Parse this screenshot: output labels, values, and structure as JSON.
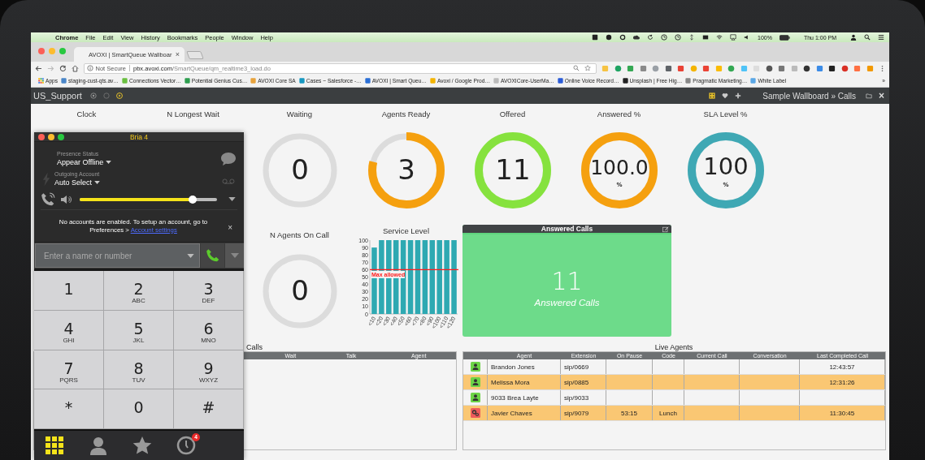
{
  "menu_bar": {
    "app": "Chrome",
    "items": [
      "File",
      "Edit",
      "View",
      "History",
      "Bookmarks",
      "People",
      "Window",
      "Help"
    ],
    "battery": "100%",
    "clock": "Thu 1:00 PM"
  },
  "browser": {
    "tab": {
      "title": "AVOXI | SmartQueue Wallboar",
      "close": "×"
    },
    "address": {
      "security": "Not Secure",
      "host": "pbx.avoxi.com",
      "path": "/SmartQueue/qm_realtime3_load.do"
    },
    "bookmarks": [
      "Apps",
      "staging-cust-qts.av…",
      "Connections Vector…",
      "Potential Genius Cus…",
      "AVOXI Core SA",
      "Cases ~ Salesforce -…",
      "AVOXI | Smart Queu…",
      "Avoxi / Google Prod…",
      "AVOXICore-UserMa…",
      "Online Voice Record…",
      "Unsplash | Free Hig…",
      "Pragmatic Marketing…",
      "White Label"
    ],
    "bookmarks_more": "»"
  },
  "app_bar": {
    "title": "US_Support",
    "breadcrumb": "Sample Wallboard » Calls",
    "close": "×"
  },
  "gauges": [
    {
      "kind": "clock",
      "label": "Clock"
    },
    {
      "kind": "label",
      "label": "N Longest Wait"
    },
    {
      "kind": "ring",
      "label": "Waiting",
      "value": "0",
      "level": 0
    },
    {
      "kind": "ring",
      "label": "Agents Ready",
      "value": "3",
      "level": 0.79,
      "color": "#f5a00f"
    },
    {
      "kind": "ring",
      "label": "Offered",
      "value": "11",
      "level": 1,
      "color": "#86e23e"
    },
    {
      "kind": "ring",
      "label": "Answered %",
      "value": "100.0",
      "unit": "%",
      "level": 1,
      "color": "#f5a00f"
    },
    {
      "kind": "ring",
      "label": "SLA Level %",
      "value": "100",
      "unit": "%",
      "level": 1,
      "color": "#3fa8b4"
    },
    {
      "kind": "ring",
      "label": "N Agents On Call",
      "value": "0",
      "level": 0
    }
  ],
  "service_level": {
    "title": "Service Level",
    "chart_data": {
      "type": "bar",
      "categories": [
        "<10",
        "<20",
        "<30",
        "<40",
        "<50",
        "<60",
        "<70",
        "<80",
        "<90",
        "<100",
        "<110",
        "<120"
      ],
      "values": [
        90,
        100,
        100,
        100,
        100,
        100,
        100,
        100,
        100,
        100,
        100,
        100
      ],
      "ylim": [
        0,
        100
      ],
      "yticks": [
        0,
        10,
        20,
        30,
        40,
        50,
        60,
        70,
        80,
        90,
        100
      ],
      "ref_lines": [
        {
          "axis": "y",
          "value": 60,
          "label": "Max allowed"
        }
      ]
    }
  },
  "answered_panel": {
    "title": "Answered Calls",
    "value": "11",
    "caption": "Answered Calls"
  },
  "calls_table": {
    "title": "Calls",
    "columns": [
      "Wait",
      "Talk",
      "Agent"
    ]
  },
  "live_agents": {
    "title": "Live Agents",
    "columns": [
      "Agent",
      "Extension",
      "On Pause",
      "Code",
      "Current Call",
      "Conversation",
      "Last Completed Call"
    ],
    "rows": [
      {
        "kind": "available",
        "highlighted": false,
        "agent": "Brandon Jones",
        "extension": "sip/0669",
        "last_call": "12:43:57"
      },
      {
        "kind": "available",
        "highlighted": true,
        "agent": "Melissa Mora",
        "extension": "sip/0885",
        "last_call": "12:31:26"
      },
      {
        "kind": "available",
        "highlighted": false,
        "agent": "9033 Brea Layte",
        "extension": "sip/9033"
      },
      {
        "kind": "paused",
        "highlighted": true,
        "agent": "Javier Chaves",
        "extension": "sip/9079",
        "on_pause": "53:15",
        "code": "Lunch",
        "last_call": "11:30:45"
      }
    ]
  },
  "softphone": {
    "title": "Bria 4",
    "presence_label": "Presence Status",
    "presence": "Appear Offline",
    "account_label": "Outgoing Account",
    "account": "Auto Select",
    "volume": {
      "level": 0.82
    },
    "message": "No accounts are enabled. To setup an account, go to Preferences > ",
    "link": "Account settings",
    "close": "×",
    "search": {
      "placeholder": "Enter a name or number"
    },
    "keys": [
      {
        "digit": "1"
      },
      {
        "digit": "2",
        "letters": "ABC"
      },
      {
        "digit": "3",
        "letters": "DEF"
      },
      {
        "digit": "4",
        "letters": "GHI"
      },
      {
        "digit": "5",
        "letters": "JKL"
      },
      {
        "digit": "6",
        "letters": "MNO"
      },
      {
        "digit": "7",
        "letters": "PQRS"
      },
      {
        "digit": "8",
        "letters": "TUV"
      },
      {
        "digit": "9",
        "letters": "WXYZ"
      },
      {
        "digit": "*"
      },
      {
        "digit": "0"
      },
      {
        "digit": "#"
      }
    ],
    "nav": [
      {
        "kind": "dialpad",
        "selected": true
      },
      {
        "kind": "contacts",
        "selected": false
      },
      {
        "kind": "favorites",
        "selected": false
      },
      {
        "kind": "history",
        "selected": false,
        "badge": "4"
      }
    ]
  }
}
